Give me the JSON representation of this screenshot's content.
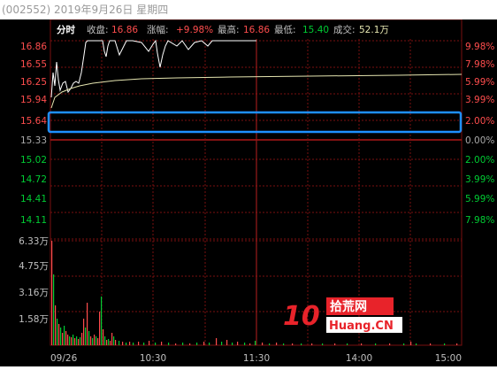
{
  "window": {
    "title": "(002552) 2019年9月26日 星期四"
  },
  "info_bar": {
    "mode": "分时",
    "close_label": "收盘:",
    "close_value": "16.86",
    "change_label": "涨幅:",
    "change_value": "+9.98%",
    "high_label": "最高:",
    "high_value": "16.86",
    "low_label": "最低:",
    "low_value": "15.40",
    "volume_label": "成交:",
    "volume_value": "52.1万"
  },
  "price_axis": {
    "left_labels": [
      "16.86",
      "16.55",
      "16.25",
      "15.94",
      "15.64",
      "15.33",
      "15.02",
      "14.72",
      "14.41",
      "14.11"
    ],
    "right_labels": [
      "9.98%",
      "7.98%",
      "5.99%",
      "3.99%",
      "2.00%",
      "0.00%",
      "2.00%",
      "3.99%",
      "5.99%",
      "7.98%"
    ]
  },
  "volume_axis": {
    "labels": [
      "6.33万",
      "4.75万",
      "3.16万",
      "1.58万"
    ]
  },
  "time_axis": {
    "labels": [
      "09/26",
      "10:30",
      "11:30",
      "14:00",
      "15:00"
    ]
  },
  "watermark": {
    "number": "10",
    "cn": "拾荒网",
    "en": "Huang.CN"
  },
  "colors": {
    "up": "#ff4d4d",
    "down": "#00cc33",
    "flat": "#aaaaaa",
    "highlight": "#1e90ff",
    "grid_red": "#7a0f0f",
    "price_line": "#ffffff",
    "avg_line": "#e5e5b0"
  }
}
